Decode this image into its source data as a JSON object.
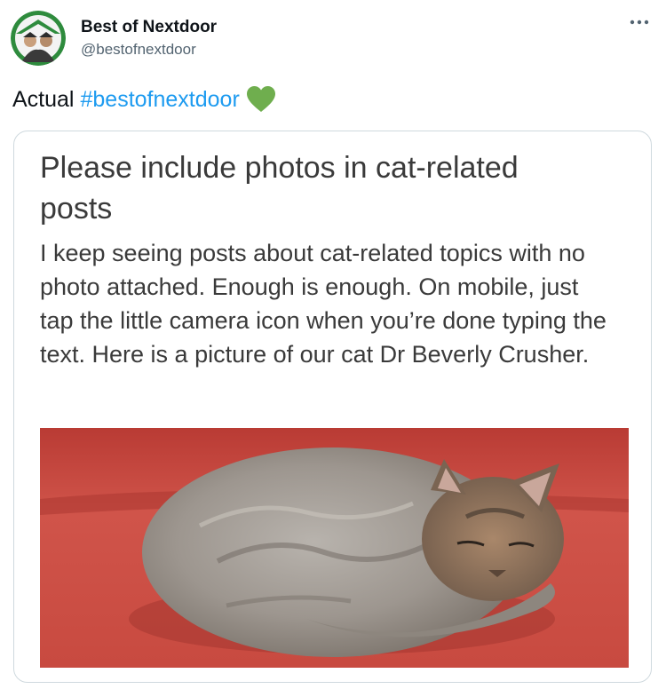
{
  "tweet": {
    "author": {
      "display_name": "Best of Nextdoor",
      "handle": "@bestofnextdoor",
      "avatar_icon": "nextdoor-avatar-icon"
    },
    "text": {
      "prefix": "Actual",
      "hashtag": "#bestofnextdoor",
      "emoji_icon": "green-heart-icon"
    },
    "more_icon": "more-options-icon"
  },
  "embedded_post": {
    "title": "Please include photos in cat-related posts",
    "body": "I keep seeing posts about cat-related topics with no photo attached. Enough is enough. On mobile, just tap the little camera icon when you’re done typing the text. Here is a picture of our cat Dr Beverly Crusher.",
    "photo": "cat-photo"
  },
  "colors": {
    "hashtag": "#1d9bf0",
    "heart": "#6fae4e",
    "text": "#0f1419",
    "secondary": "#536471",
    "card_border": "#cfd9de",
    "post_text": "#3a3a3a",
    "couch_red": "#cc4a40"
  }
}
